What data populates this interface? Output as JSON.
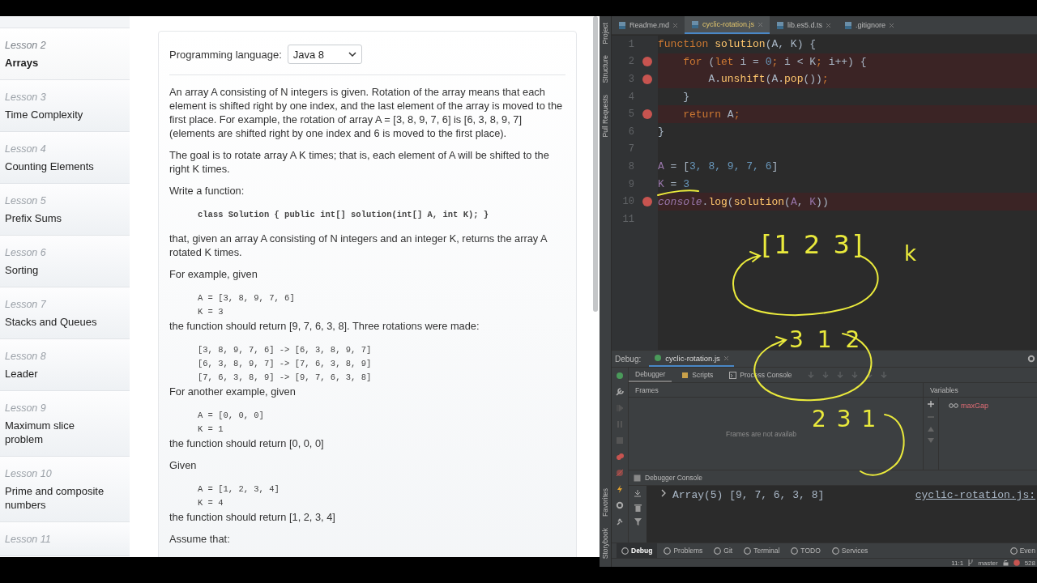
{
  "browser": {
    "sidebar": {
      "items": [
        {
          "lesson": "Lesson 2",
          "title": "Arrays",
          "selected": true
        },
        {
          "lesson": "Lesson 3",
          "title": "Time Complexity",
          "selected": false
        },
        {
          "lesson": "Lesson 4",
          "title": "Counting Elements",
          "selected": false
        },
        {
          "lesson": "Lesson 5",
          "title": "Prefix Sums",
          "selected": false
        },
        {
          "lesson": "Lesson 6",
          "title": "Sorting",
          "selected": false
        },
        {
          "lesson": "Lesson 7",
          "title": "Stacks and Queues",
          "selected": false
        },
        {
          "lesson": "Lesson 8",
          "title": "Leader",
          "selected": false
        },
        {
          "lesson": "Lesson 9",
          "title": "Maximum slice problem",
          "selected": false
        },
        {
          "lesson": "Lesson 10",
          "title": "Prime and composite numbers",
          "selected": false
        },
        {
          "lesson": "Lesson 11",
          "selected": false
        }
      ]
    },
    "task": {
      "language_label": "Programming language:",
      "language": "Java 8",
      "blocks": [
        {
          "kind": "text",
          "text": "An array A consisting of N integers is given. Rotation of the array means that each element is shifted right by one index, and the last element of the array is moved to the first place. For example, the rotation of array A = [3, 8, 9, 7, 6] is [6, 3, 8, 9, 7] (elements are shifted right by one index and 6 is moved to the first place)."
        },
        {
          "kind": "text",
          "text": "The goal is to rotate array A K times; that is, each element of A will be shifted to the right K times."
        },
        {
          "kind": "text",
          "text": "Write a function:"
        },
        {
          "kind": "code",
          "lines": [
            "class Solution { public int[] solution(int[] A, int K); }"
          ]
        },
        {
          "kind": "text",
          "text": "that, given an array A consisting of N integers and an integer K, returns the array A rotated K times."
        },
        {
          "kind": "text",
          "text": "For example, given"
        },
        {
          "kind": "code",
          "lines": [
            "A = [3, 8, 9, 7, 6]",
            "K = 3"
          ]
        },
        {
          "kind": "text",
          "text": "the function should return [9, 7, 6, 3, 8]. Three rotations were made:"
        },
        {
          "kind": "code",
          "lines": [
            "[3, 8, 9, 7, 6] -> [6, 3, 8, 9, 7]",
            "[6, 3, 8, 9, 7] -> [7, 6, 3, 8, 9]",
            "[7, 6, 3, 8, 9] -> [9, 7, 6, 3, 8]"
          ]
        },
        {
          "kind": "text",
          "text": "For another example, given"
        },
        {
          "kind": "code",
          "lines": [
            "A = [0, 0, 0]",
            "K = 1"
          ]
        },
        {
          "kind": "text",
          "text": "the function should return [0, 0, 0]"
        },
        {
          "kind": "text",
          "text": "Given"
        },
        {
          "kind": "code",
          "lines": [
            "A = [1, 2, 3, 4]",
            "K = 4"
          ]
        },
        {
          "kind": "text",
          "text": "the function should return [1, 2, 3, 4]"
        },
        {
          "kind": "text",
          "text": "Assume that:"
        }
      ]
    }
  },
  "ide": {
    "side_tools_top": [
      "Project",
      "Structure",
      "Pull Requests"
    ],
    "side_tools_bottom": [
      "Favorites",
      "Storybook"
    ],
    "tabs": [
      {
        "label": "Readme.md",
        "selected": false
      },
      {
        "label": "cyclic-rotation.js",
        "selected": true
      },
      {
        "label": "lib.es5.d.ts",
        "selected": false
      },
      {
        "label": ".gitignore",
        "selected": false
      }
    ],
    "code": [
      {
        "number": "1",
        "breakpoint": false,
        "tokens": [
          {
            "kind": "keyword",
            "text": "function "
          },
          {
            "kind": "function",
            "text": "solution"
          },
          {
            "kind": "plain",
            "text": "(A, K) {"
          }
        ]
      },
      {
        "number": "2",
        "breakpoint": true,
        "tokens": [
          {
            "kind": "keyword",
            "text": "    for"
          },
          {
            "kind": "plain",
            "text": " ("
          },
          {
            "kind": "keyword",
            "text": "let"
          },
          {
            "kind": "plain",
            "text": " i = "
          },
          {
            "kind": "number",
            "text": "0"
          },
          {
            "kind": "keyword",
            "text": ";"
          },
          {
            "kind": "plain",
            "text": " i < K"
          },
          {
            "kind": "keyword",
            "text": ";"
          },
          {
            "kind": "plain",
            "text": " i++) {"
          }
        ]
      },
      {
        "number": "3",
        "breakpoint": true,
        "tokens": [
          {
            "kind": "plain",
            "text": "        A."
          },
          {
            "kind": "function",
            "text": "unshift"
          },
          {
            "kind": "plain",
            "text": "(A."
          },
          {
            "kind": "function",
            "text": "pop"
          },
          {
            "kind": "plain",
            "text": "())"
          },
          {
            "kind": "keyword",
            "text": ";"
          }
        ]
      },
      {
        "number": "4",
        "breakpoint": false,
        "tokens": [
          {
            "kind": "plain",
            "text": "    }"
          }
        ]
      },
      {
        "number": "5",
        "breakpoint": true,
        "tokens": [
          {
            "kind": "keyword",
            "text": "    return"
          },
          {
            "kind": "plain",
            "text": " A"
          },
          {
            "kind": "keyword",
            "text": ";"
          }
        ]
      },
      {
        "number": "6",
        "breakpoint": false,
        "tokens": [
          {
            "kind": "plain",
            "text": "}"
          }
        ]
      },
      {
        "number": "7",
        "breakpoint": false
      },
      {
        "number": "8",
        "breakpoint": false,
        "tokens": [
          {
            "kind": "variable",
            "text": "A"
          },
          {
            "kind": "plain",
            "text": " = ["
          },
          {
            "kind": "number",
            "text": "3, 8, 9, 7, 6"
          },
          {
            "kind": "plain",
            "text": "]"
          }
        ]
      },
      {
        "number": "9",
        "breakpoint": false,
        "tokens": [
          {
            "kind": "variable",
            "text": "K"
          },
          {
            "kind": "plain",
            "text": " = "
          },
          {
            "kind": "number",
            "text": "3"
          }
        ]
      },
      {
        "number": "10",
        "breakpoint": true,
        "tokens": [
          {
            "kind": "global",
            "text": "console"
          },
          {
            "kind": "plain",
            "text": "."
          },
          {
            "kind": "function",
            "text": "log"
          },
          {
            "kind": "plain",
            "text": "("
          },
          {
            "kind": "function",
            "text": "solution"
          },
          {
            "kind": "plain",
            "text": "("
          },
          {
            "kind": "variable",
            "text": "A"
          },
          {
            "kind": "plain",
            "text": ", "
          },
          {
            "kind": "variable",
            "text": "K"
          },
          {
            "kind": "plain",
            "text": "))"
          }
        ]
      },
      {
        "number": "11",
        "breakpoint": false
      }
    ],
    "annotations": [
      "[1 2 3]",
      "k",
      "3 1 2",
      "2 3 1"
    ],
    "debug": {
      "label": "Debug:",
      "session": "cyclic-rotation.js",
      "tabs": [
        {
          "label": "Debugger",
          "selected": true
        },
        {
          "label": "Scripts",
          "selected": false
        },
        {
          "label": "Process Console",
          "selected": false
        }
      ],
      "frames_title": "Frames",
      "frames_empty": "Frames are not availab",
      "variables_title": "Variables",
      "watches": [
        "maxGap"
      ],
      "console_title": "Debugger Console",
      "console_output": "Array(5) [9, 7, 6, 3, 8]",
      "console_source": "cyclic-rotation.js:"
    },
    "tool_windows": [
      {
        "label": "Debug",
        "selected": true
      },
      {
        "label": "Problems",
        "selected": false
      },
      {
        "label": "Git",
        "selected": false
      },
      {
        "label": "Terminal",
        "selected": false
      },
      {
        "label": "TODO",
        "selected": false
      },
      {
        "label": "Services",
        "selected": false
      },
      {
        "label": "Even",
        "selected": false
      }
    ],
    "status": {
      "position": "11:1",
      "branch": "master",
      "memory": "528"
    }
  }
}
